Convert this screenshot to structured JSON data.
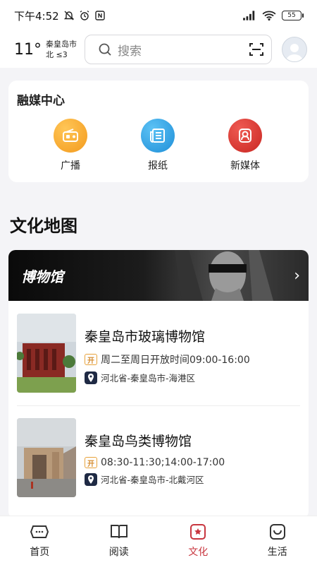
{
  "statusbar": {
    "time": "下午4:52",
    "battery": "55"
  },
  "header": {
    "temperature": "11°",
    "city": "秦皇岛市",
    "wind": "北 ≤3",
    "search_placeholder": "搜索"
  },
  "media_center": {
    "title": "融媒中心",
    "items": [
      {
        "label": "广播",
        "icon": "radio-icon",
        "color": "#f5a623"
      },
      {
        "label": "报纸",
        "icon": "newspaper-icon",
        "color": "#2f9fe3"
      },
      {
        "label": "新媒体",
        "icon": "new-media-icon",
        "color": "#d9352f"
      }
    ]
  },
  "culture_map": {
    "title": "文化地图",
    "banner_title": "博物馆",
    "museums": [
      {
        "name": "秦皇岛市玻璃博物馆",
        "open_tag": "开",
        "hours": "周二至周日开放时间09:00-16:00",
        "address": "河北省-秦皇岛市-海港区"
      },
      {
        "name": "秦皇岛鸟类博物馆",
        "open_tag": "开",
        "hours": "08:30-11:30;14:00-17:00",
        "address": "河北省-秦皇岛市-北戴河区"
      }
    ]
  },
  "tabbar": {
    "tabs": [
      {
        "label": "首页",
        "icon": "home-icon"
      },
      {
        "label": "阅读",
        "icon": "book-icon"
      },
      {
        "label": "文化",
        "icon": "culture-icon",
        "active": true
      },
      {
        "label": "生活",
        "icon": "life-icon"
      }
    ],
    "active_color": "#c8363f"
  }
}
